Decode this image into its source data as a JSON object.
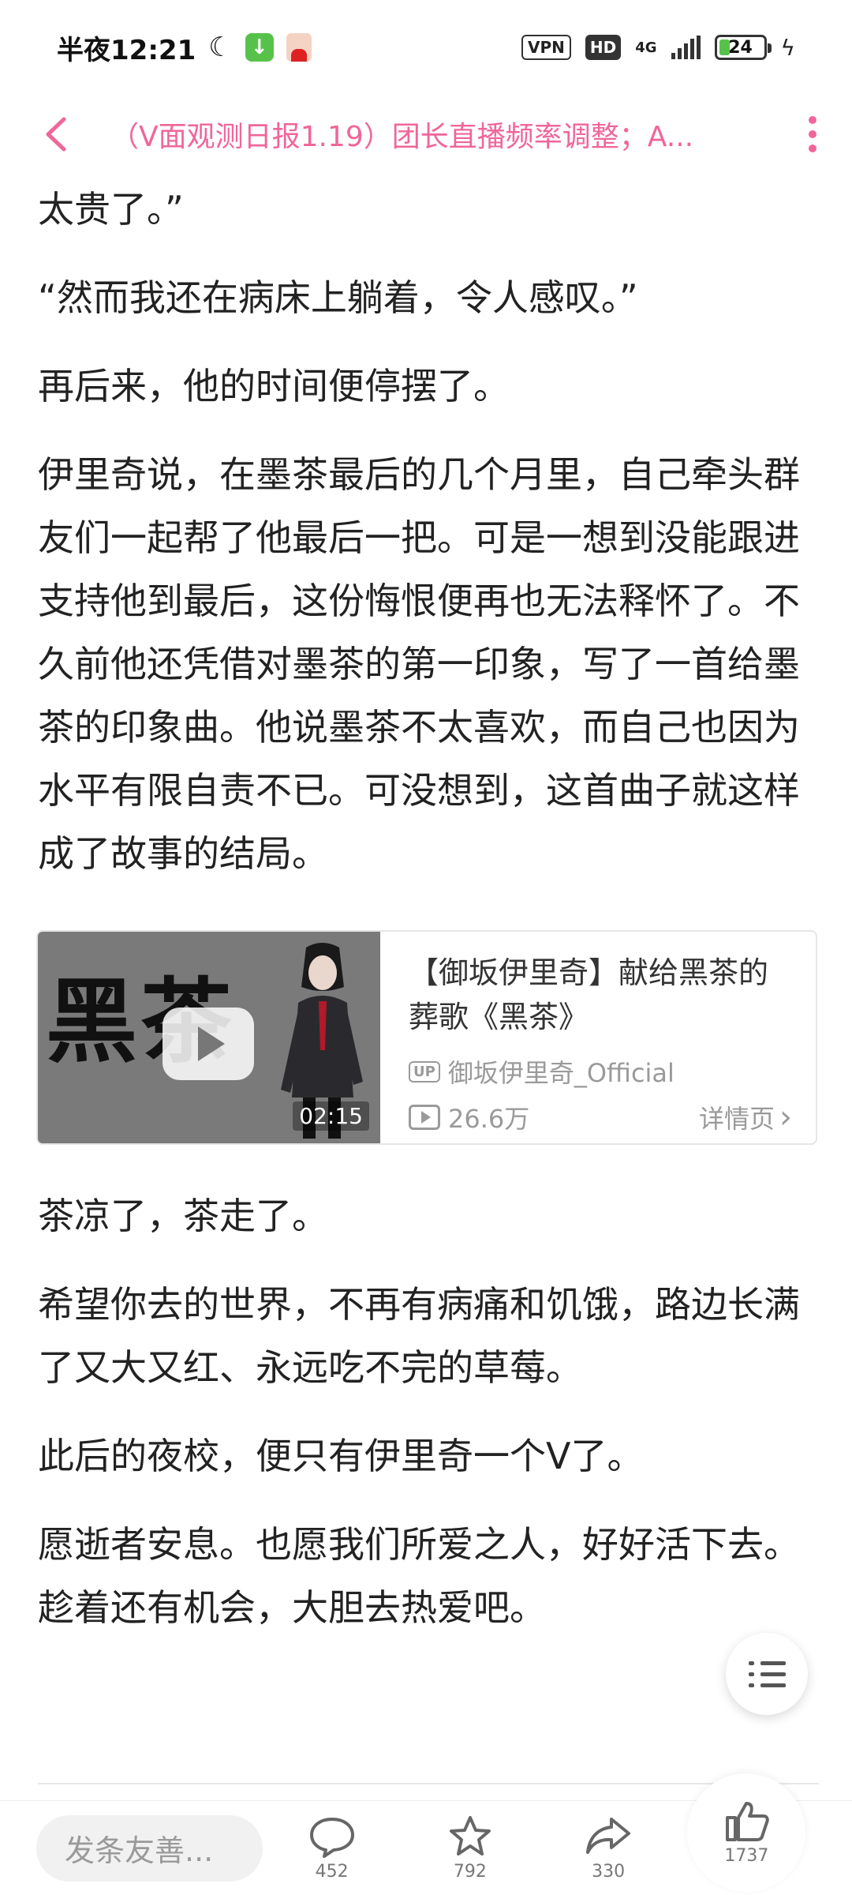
{
  "status_bar": {
    "time": "半夜12:21",
    "vpn": "VPN",
    "hd": "HD",
    "network": "4G",
    "battery": "24",
    "battery_level": 0.24
  },
  "header": {
    "title": "（V面观测日报1.19）团长直播频率调整；A..."
  },
  "article_top": [
    "太贵了。”",
    "“然而我还在病床上躺着，令人感叹。”",
    "再后来，他的时间便停摆了。",
    "伊里奇说，在墨茶最后的几个月里，自己牵头群友们一起帮了他最后一把。可是一想到没能跟进支持他到最后，这份悔恨便再也无法释怀了。不久前他还凭借对墨茶的第一印象，写了一首给墨茶的印象曲。他说墨茶不太喜欢，而自己也因为水平有限自责不已。可没想到，这首曲子就这样成了故事的结局。"
  ],
  "video": {
    "thumb_text": "黑茶",
    "duration": "02:15",
    "title": "【御坂伊里奇】献给黑茶的葬歌《黑茶》",
    "up_badge": "UP",
    "author": "御坂伊里奇_Official",
    "plays": "26.6万",
    "detail_label": "详情页",
    "detail_chevron": "›"
  },
  "article_bottom": [
    "茶凉了，茶走了。",
    "希望你去的世界，不再有病痛和饥饿，路边长满了又大又红、永远吃不完的草莓。",
    "此后的夜校，便只有伊里奇一个V了。",
    "愿逝者安息。也愿我们所爱之人，好好活下去。趁着还有机会，大胆去热爱吧。"
  ],
  "bottom_bar": {
    "comment_placeholder": "发条友善...",
    "comments_count": "452",
    "favorites_count": "792",
    "shares_count": "330",
    "likes_count": "1737"
  },
  "colors": {
    "accent": "#f0669a",
    "text": "#222222",
    "muted": "#9a9a9a"
  }
}
